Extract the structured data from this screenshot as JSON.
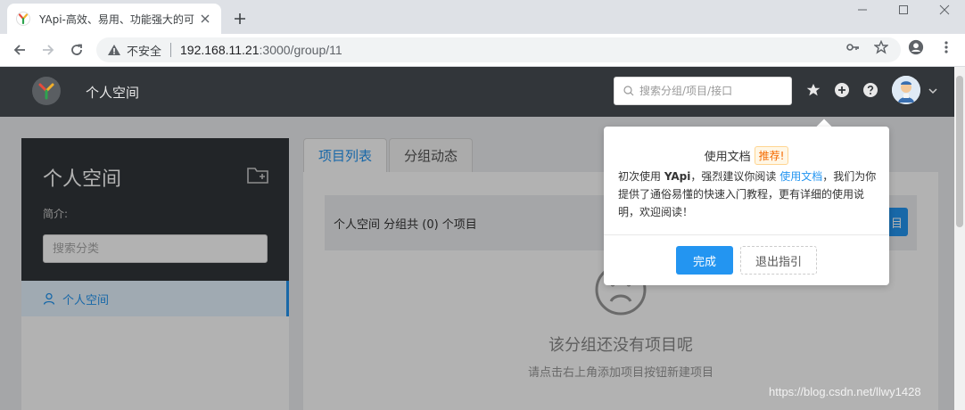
{
  "browser": {
    "tab_title": "YApi-高效、易用、功能强大的可",
    "insecure_label": "不安全",
    "url_host": "192.168.11.21",
    "url_rest": ":3000/group/11"
  },
  "header": {
    "title": "个人空间",
    "search_placeholder": "搜索分组/项目/接口"
  },
  "group_panel": {
    "name": "个人空间",
    "desc_label": "简介:",
    "search_placeholder": "搜索分类",
    "items": [
      {
        "label": "个人空间"
      }
    ]
  },
  "main": {
    "tabs": [
      {
        "label": "项目列表"
      },
      {
        "label": "分组动态"
      }
    ],
    "summary": "个人空间 分组共 (0) 个项目",
    "add_button_partial": "目",
    "empty_title": "该分组还没有项目呢",
    "empty_hint": "请点击右上角添加项目按钮新建项目"
  },
  "popover": {
    "title": "使用文档",
    "badge": "推荐!",
    "body_1": "初次使用 ",
    "body_bold": "YApi",
    "body_2": "，强烈建议你阅读 ",
    "body_link": "使用文档",
    "body_3": "，我们为你提供了通俗易懂的快速入门教程，更有详细的使用说明，欢迎阅读！",
    "done_label": "完成",
    "exit_label": "退出指引"
  },
  "watermark": "https://blog.csdn.net/llwy1428",
  "colors": {
    "accent": "#2395f1",
    "header_bg": "#32363a",
    "badge_text": "#f56a00"
  }
}
